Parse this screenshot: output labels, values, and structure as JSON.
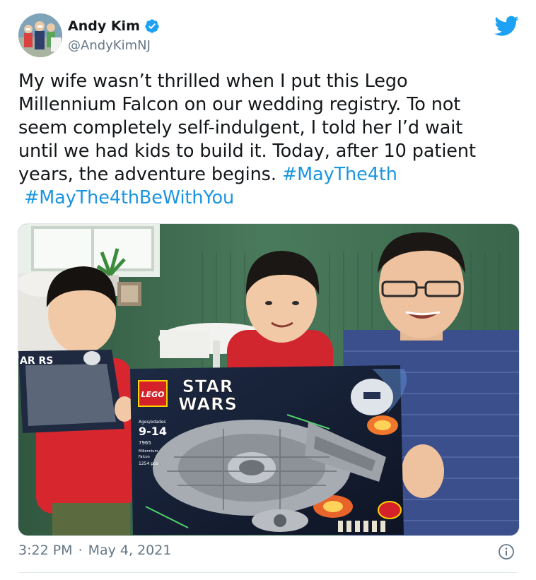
{
  "tweet": {
    "author": {
      "name": "Andy Kim",
      "handle": "@AndyKimNJ",
      "verified": true
    },
    "text": {
      "lines": [
        "My wife wasn’t thrilled when I put this Lego",
        "Millennium Falcon on our wedding registry. To not",
        "seem completely self-indulgent, I told her I’d wait",
        "until we had kids to build it. Today, after 10 patient",
        "years, the adventure begins. "
      ],
      "hashtags": [
        "#MayThe4th",
        "#MayThe4thBeWithYou"
      ]
    },
    "photo": {
      "box_brand": "LEGO",
      "box_title_1": "STAR",
      "box_title_2": "WARS",
      "box_age": "9-14",
      "box_age_label": "Ages/edades",
      "box_set_number": "7965",
      "box_set_name_1": "Millennium",
      "box_set_name_2": "Falcon",
      "box_pieces": "1254 pcs",
      "manual_text": "AR RS"
    },
    "time": "3:22 PM",
    "separator": "·",
    "date": "May 4, 2021"
  },
  "colors": {
    "link": "#1b95e0",
    "twitter_blue": "#1da1f2",
    "secondary_text": "#657786",
    "wall_green": "#3f6b52"
  },
  "icons": {
    "verified": "verified-badge-icon",
    "logo": "twitter-bird-icon",
    "info": "info-circle-icon"
  }
}
